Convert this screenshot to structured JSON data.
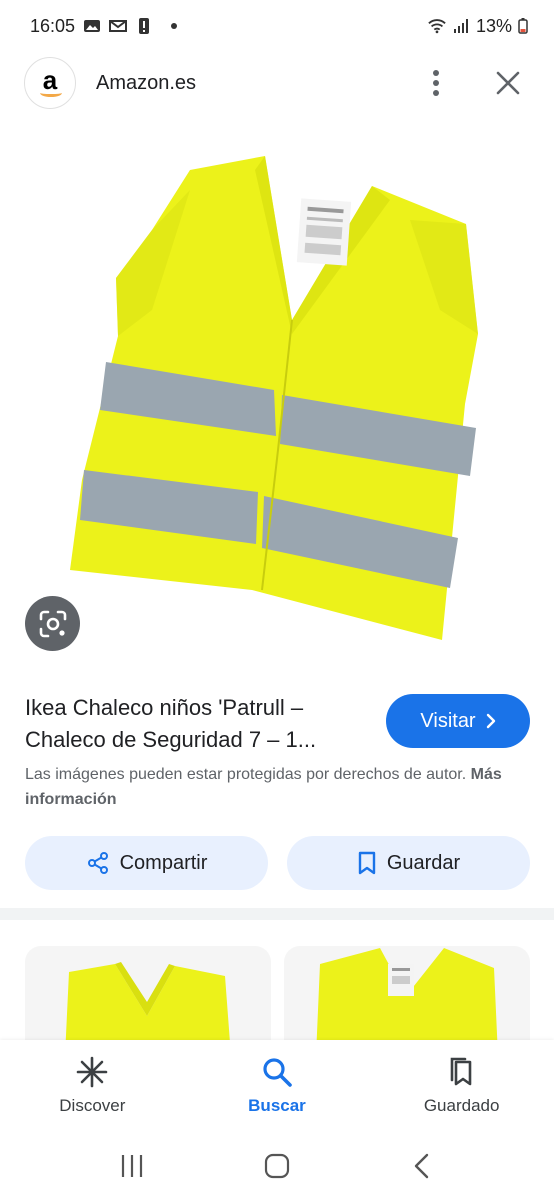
{
  "status_bar": {
    "time": "16:05",
    "battery": "13%"
  },
  "header": {
    "site_name": "Amazon.es",
    "logo_letter": "a"
  },
  "result": {
    "title": "Ikea Chaleco niños 'Patrull – Chaleco de Seguridad 7 – 1...",
    "visit_label": "Visitar",
    "copyright_text": "Las imágenes pueden estar protegidas por derechos de autor.",
    "more_info": "Más información"
  },
  "actions": {
    "share_label": "Compartir",
    "save_label": "Guardar"
  },
  "bottom_nav": [
    {
      "label": "Discover",
      "icon": "discover-icon"
    },
    {
      "label": "Buscar",
      "icon": "search-icon"
    },
    {
      "label": "Guardado",
      "icon": "saved-icon"
    }
  ],
  "colors": {
    "accent": "#1a73e8",
    "chip_bg": "#e8f0fe",
    "vest_yellow": "#ecf21a",
    "reflective": "#9aa6b0"
  }
}
